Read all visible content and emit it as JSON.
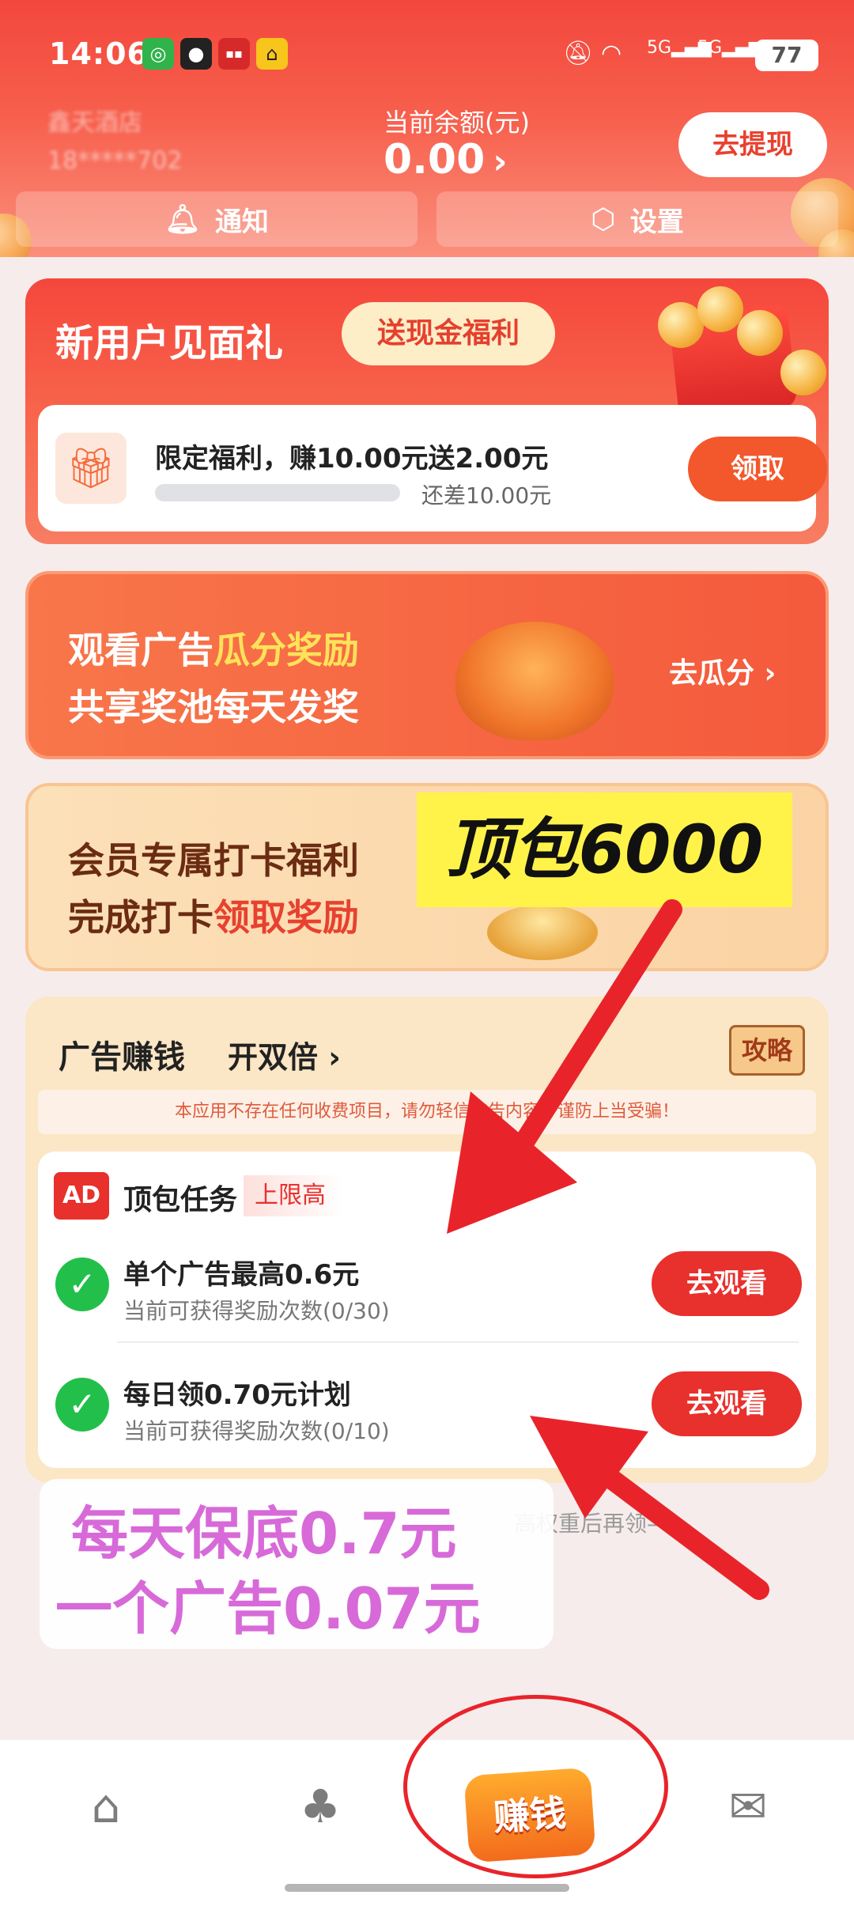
{
  "status_bar": {
    "time": "14:06",
    "battery": "77",
    "network_1": "5G",
    "network_2": "5G"
  },
  "header": {
    "shop_name": "鑫天酒店",
    "shop_phone": "18*****702",
    "balance_label": "当前余额(元)",
    "balance_value": "0.00",
    "balance_chevron": "›",
    "withdraw_label": "去提现",
    "notice_label": "通知",
    "settings_label": "设置"
  },
  "new_user": {
    "title": "新用户见面礼",
    "pill": "送现金福利",
    "task_label": "限定福利，赚10.00元送2.00元",
    "progress": 0,
    "remaining": "还差10.00元",
    "claim_label": "领取"
  },
  "ad_pool": {
    "line1_prefix": "观看广告",
    "line1_highlight": "瓜分奖励",
    "line2": "共享奖池每天发奖",
    "cta": "去瓜分 ›"
  },
  "checkin": {
    "line1": "会员专属打卡福利",
    "line2_prefix": "完成打卡",
    "line2_highlight": "领取奖励"
  },
  "ad_earn": {
    "title": "广告赚钱",
    "double": "开双倍 ›",
    "guide": "攻略",
    "warning": "本应用不存在任何收费项目，请勿轻信广告内容，谨防上当受骗！",
    "task_header": "顶包任务",
    "cap_tag": "上限高",
    "ad_badge": "AD",
    "tasks": [
      {
        "name": "单个广告最高0.6元",
        "sub": "当前可获得奖励次数(0/30)",
        "button": "去观看"
      },
      {
        "name": "每日领0.70元计划",
        "sub": "当前可获得奖励次数(0/10)",
        "button": "去观看"
      }
    ],
    "tip": "高权重后再领——"
  },
  "overlays": {
    "yellow_text": "顶包6000",
    "pink_line1": "每天保底0.7元",
    "pink_line2": "一个广告0.07元"
  },
  "bottom_nav": {
    "earn_label": "赚钱",
    "icons": [
      "home-icon",
      "tree-icon",
      "earn-icon",
      "mail-heart-icon"
    ]
  },
  "colors": {
    "brand_red": "#e8302c",
    "header_gradient_top": "#f2473d",
    "success_green": "#22c04a",
    "annotation_red": "#e8242a"
  }
}
